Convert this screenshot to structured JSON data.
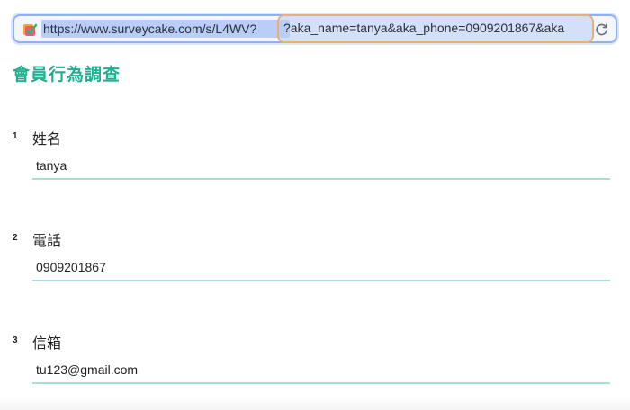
{
  "browser": {
    "url_prefix": "https://www.surveycake.com/s/L4WV?",
    "url_params": "?aka_name=tanya&aka_phone=0909201867&aka",
    "favicon": "survey-favicon",
    "reload_icon": "reload-icon"
  },
  "survey": {
    "title": "會員行為調查",
    "accent_color": "#1fae8f",
    "questions": [
      {
        "number": "1",
        "label": "姓名",
        "value": "tanya"
      },
      {
        "number": "2",
        "label": "電話",
        "value": "0909201867"
      },
      {
        "number": "3",
        "label": "信箱",
        "value": "tu123@gmail.com"
      }
    ]
  }
}
